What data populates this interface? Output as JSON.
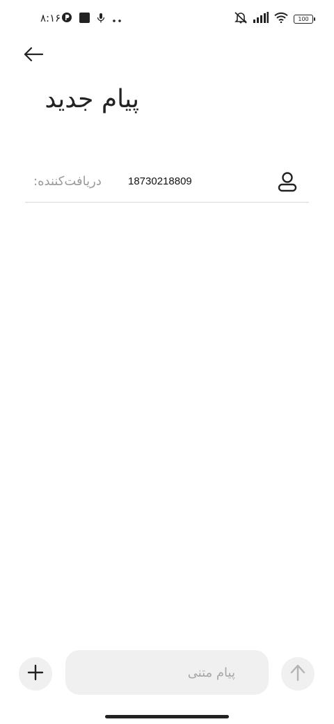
{
  "status_bar": {
    "time": "۸:۱۶",
    "battery": "100",
    "icons": [
      "notification-icon",
      "screen-record-icon",
      "microphone-icon",
      "more-dots-icon",
      "mute-icon",
      "signal-icon",
      "wifi-icon",
      "battery-icon"
    ]
  },
  "header": {
    "title": "پیام جدید",
    "back_icon": "arrow-left-icon"
  },
  "recipient": {
    "label": "دریافت‌کننده:",
    "number": "18730218809",
    "contact_icon": "person-icon"
  },
  "composer": {
    "placeholder": "پیام متنی",
    "attach_icon": "plus-icon",
    "send_icon": "arrow-up-icon"
  },
  "colors": {
    "background": "#ffffff",
    "input_bg": "#f0f0f0",
    "divider": "#d9d9d9",
    "placeholder": "#a7a7a7",
    "text": "#222222"
  }
}
